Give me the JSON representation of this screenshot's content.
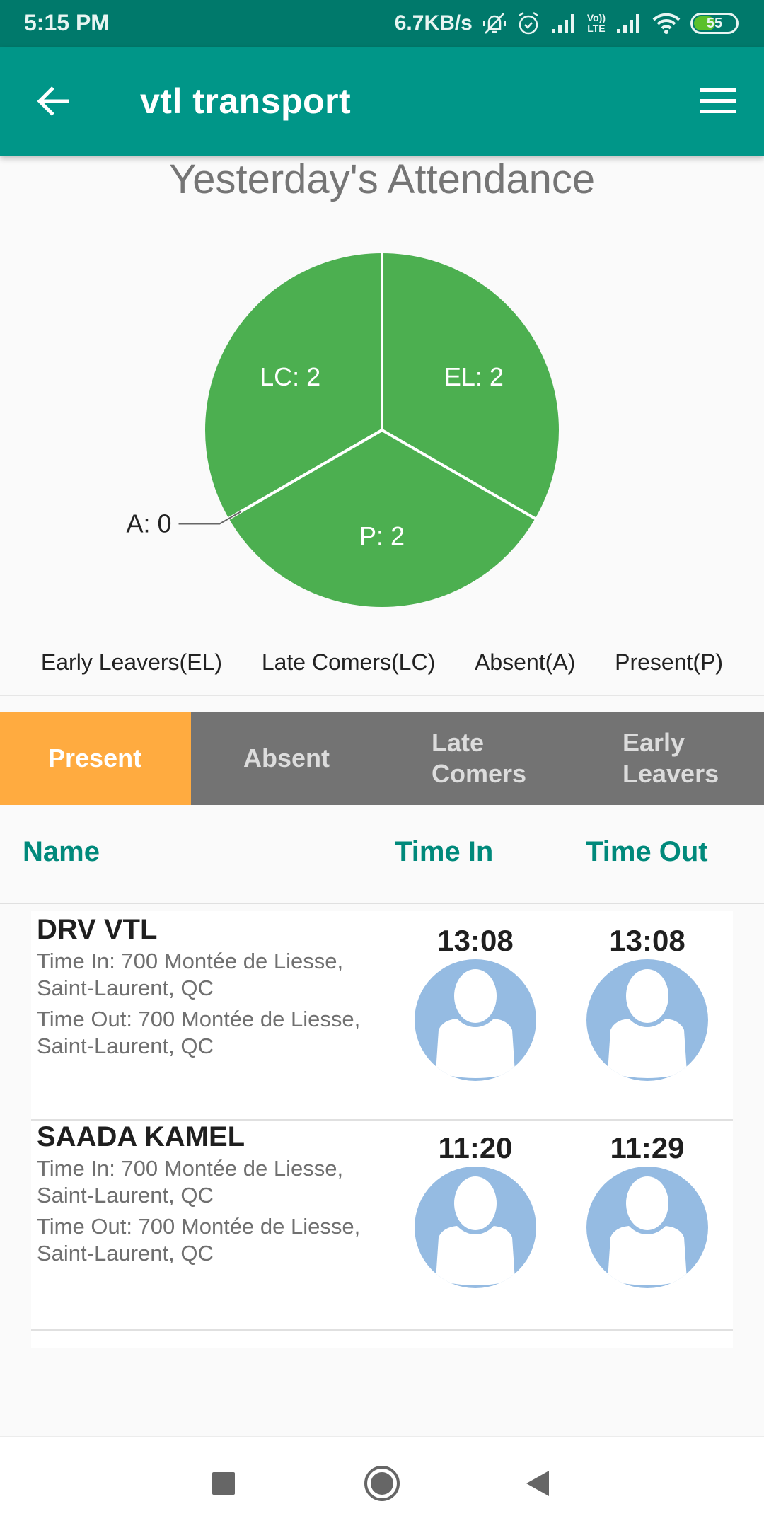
{
  "status_bar": {
    "time": "5:15 PM",
    "network_speed": "6.7KB/s",
    "icons": [
      "bell-off-icon",
      "alarm-icon",
      "signal-icon",
      "volte-icon",
      "signal-icon",
      "wifi-icon",
      "battery-icon"
    ],
    "volte_label_top": "Vo))",
    "volte_label_bottom": "LTE",
    "battery_level": "55",
    "battery_fraction": 0.55
  },
  "app_bar": {
    "title": "vtl transport",
    "back_icon": "arrow-left-icon",
    "menu_icon": "hamburger-menu-icon"
  },
  "chart_data": {
    "type": "pie",
    "title": "Yesterday's Attendance",
    "slices": [
      {
        "key": "EL",
        "label": "EL: 2",
        "value": 2,
        "color": "#4caf50"
      },
      {
        "key": "P",
        "label": "P: 2",
        "value": 2,
        "color": "#4caf50"
      },
      {
        "key": "A",
        "label": "A: 0",
        "value": 0,
        "color": "#4caf50"
      },
      {
        "key": "LC",
        "label": "LC: 2",
        "value": 2,
        "color": "#4caf50"
      }
    ],
    "legend": [
      "Early Leavers(EL)",
      "Late Comers(LC)",
      "Absent(A)",
      "Present(P)"
    ],
    "legend_position": "bottom"
  },
  "tabs": [
    {
      "label": "Present",
      "active": true
    },
    {
      "label": "Absent",
      "active": false
    },
    {
      "label": "Late\nComers",
      "line1": "Late",
      "line2": "Comers",
      "active": false
    },
    {
      "label": "Early\nLeavers",
      "line1": "Early",
      "line2": "Leavers",
      "active": false
    }
  ],
  "colors": {
    "primary": "#009688",
    "primary_dark": "#00796b",
    "accent_tab": "#ffab40",
    "tab_inactive": "#737373",
    "header_text": "#00897b",
    "pie_green": "#4caf50",
    "avatar_bg": "#95bbe2"
  },
  "list": {
    "headers": {
      "name": "Name",
      "time_in": "Time In",
      "time_out": "Time Out"
    },
    "rows": [
      {
        "name": "DRV VTL",
        "time_in_address": "Time In: 700 Montée de Liesse, Saint-Laurent, QC",
        "time_out_address": "Time Out: 700 Montée de Liesse, Saint-Laurent, QC",
        "time_in": "13:08",
        "time_out": "13:08"
      },
      {
        "name": "SAADA KAMEL",
        "time_in_address": "Time In: 700 Montée de Liesse, Saint-Laurent, QC",
        "time_out_address": "Time Out: 700 Montée de Liesse, Saint-Laurent, QC",
        "time_in": "11:20",
        "time_out": "11:29"
      }
    ]
  },
  "nav_bar": {
    "buttons": [
      "recents-square-icon",
      "home-circle-icon",
      "back-triangle-icon"
    ]
  }
}
